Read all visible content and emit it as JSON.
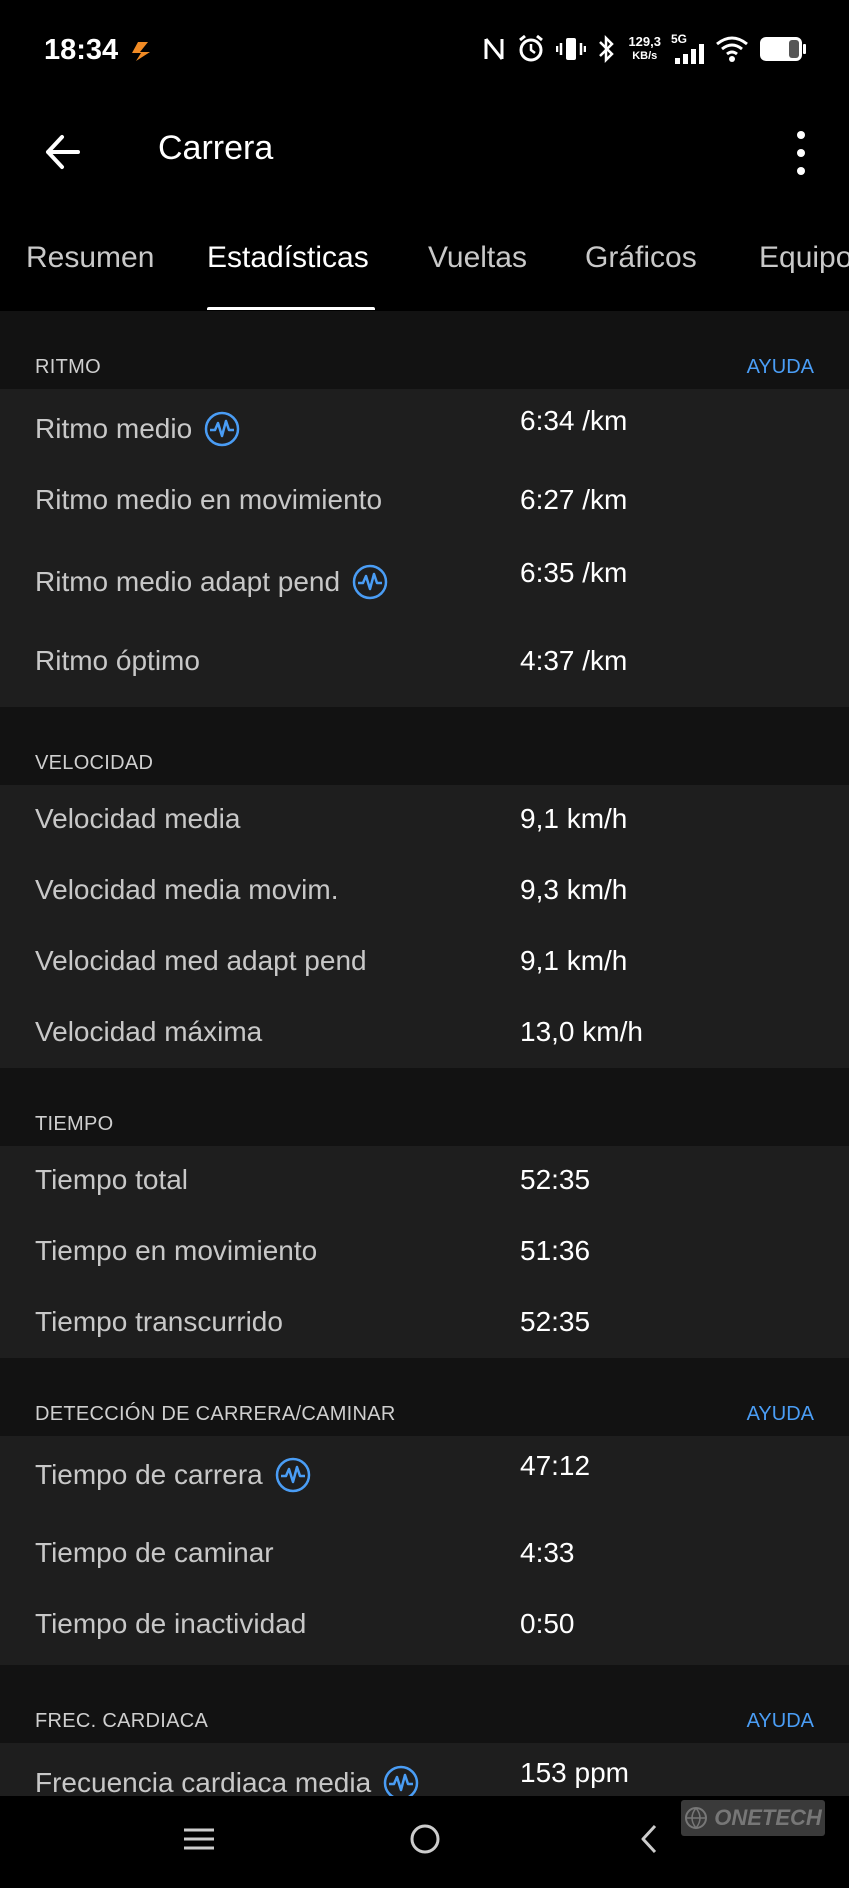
{
  "status_bar": {
    "time": "18:34",
    "net_speed_value": "129,3",
    "net_speed_unit": "KB/s",
    "network_type": "5G",
    "icons": [
      "nfc-icon",
      "alarm-icon",
      "vibrate-icon",
      "bluetooth-icon",
      "signal-icon",
      "wifi-icon",
      "battery-icon"
    ]
  },
  "app_bar": {
    "title": "Carrera",
    "icons": [
      "back-arrow-icon",
      "more-vert-icon"
    ]
  },
  "tabs": [
    {
      "label": "Resumen",
      "active": false
    },
    {
      "label": "Estadísticas",
      "active": true
    },
    {
      "label": "Vueltas",
      "active": false
    },
    {
      "label": "Gráficos",
      "active": false
    },
    {
      "label": "Equipo",
      "active": false
    }
  ],
  "sections": {
    "ritmo": {
      "title": "RITMO",
      "help": "AYUDA",
      "rows": [
        {
          "label": "Ritmo medio",
          "value": "6:34 /km",
          "icon": "wave-icon"
        },
        {
          "label": "Ritmo medio en movimiento",
          "value": "6:27 /km"
        },
        {
          "label": "Ritmo medio adapt pend",
          "value": "6:35 /km",
          "icon": "wave-icon"
        },
        {
          "label": "Ritmo óptimo",
          "value": "4:37 /km"
        }
      ]
    },
    "velocidad": {
      "title": "VELOCIDAD",
      "rows": [
        {
          "label": "Velocidad media",
          "value": "9,1 km/h"
        },
        {
          "label": "Velocidad media movim.",
          "value": "9,3 km/h"
        },
        {
          "label": "Velocidad med adapt pend",
          "value": "9,1 km/h"
        },
        {
          "label": "Velocidad máxima",
          "value": "13,0 km/h"
        }
      ]
    },
    "tiempo": {
      "title": "TIEMPO",
      "rows": [
        {
          "label": "Tiempo total",
          "value": "52:35"
        },
        {
          "label": "Tiempo en movimiento",
          "value": "51:36"
        },
        {
          "label": "Tiempo transcurrido",
          "value": "52:35"
        }
      ]
    },
    "deteccion": {
      "title": "DETECCIÓN DE CARRERA/CAMINAR",
      "help": "AYUDA",
      "rows": [
        {
          "label": "Tiempo de carrera",
          "value": "47:12",
          "icon": "wave-icon"
        },
        {
          "label": "Tiempo de caminar",
          "value": "4:33"
        },
        {
          "label": "Tiempo de inactividad",
          "value": "0:50"
        }
      ]
    },
    "frec": {
      "title": "FREC. CARDIACA",
      "help": "AYUDA",
      "rows": [
        {
          "label": "Frecuencia cardiaca media",
          "value": "153 ppm",
          "icon": "wave-icon"
        }
      ]
    }
  },
  "watermark": "ONETECH",
  "nav_bar": {
    "icons": [
      "menu-icon",
      "home-circle-icon",
      "back-triangle-icon"
    ]
  },
  "colors": {
    "accent": "#4a9df5",
    "background": "#000000",
    "section_bg": "#121212",
    "row_bg": "#1e1e1e"
  }
}
